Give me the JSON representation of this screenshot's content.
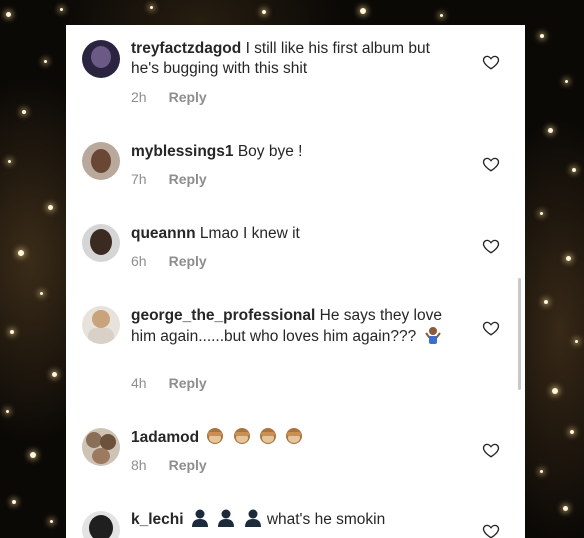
{
  "comments": [
    {
      "username": "treyfactzdagod",
      "text": "I still like his first album but he's bugging with this shit",
      "time": "2h",
      "reply_label": "Reply",
      "avatar_color": "#2a2440",
      "like_icon": "heart-outline-icon"
    },
    {
      "username": "myblessings1",
      "text": "Boy bye !",
      "time": "7h",
      "reply_label": "Reply",
      "avatar_color": "#7a5a48",
      "like_icon": "heart-outline-icon"
    },
    {
      "username": "queannn",
      "text": "Lmao I knew it",
      "time": "6h",
      "reply_label": "Reply",
      "avatar_color": "#3b2a22",
      "like_icon": "heart-outline-icon"
    },
    {
      "username": "george_the_professional",
      "text": "He says they love him again......but who loves him again???",
      "emoji": "man-shrugging-emoji",
      "time": "4h",
      "reply_label": "Reply",
      "avatar_color": "#c9a37c",
      "like_icon": "heart-outline-icon"
    },
    {
      "username": "1adamod",
      "text": "",
      "emoji": "see-no-evil-monkey-emoji x4",
      "time": "8h",
      "reply_label": "Reply",
      "avatar_color": "#8a6f58",
      "like_icon": "heart-outline-icon"
    },
    {
      "username": "k_lechi",
      "text": "what's he smokin",
      "emoji": "person-silhouette-emoji x3",
      "avatar_color": "#1f1f1f",
      "like_icon": "heart-outline-icon"
    }
  ]
}
